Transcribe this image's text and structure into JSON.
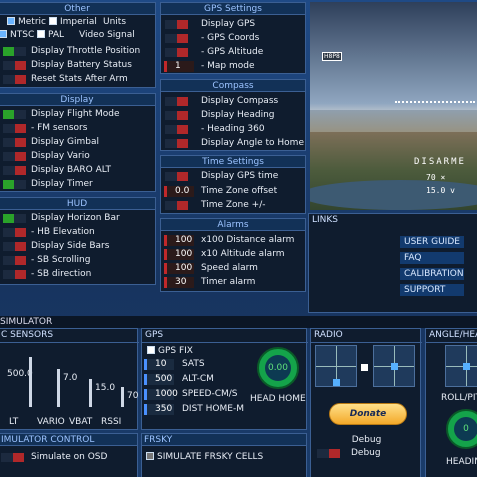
{
  "colors": {
    "on": "#2aa22a",
    "off": "#b0282a"
  },
  "other": {
    "title": "Other",
    "units": [
      "Metric",
      "Imperial",
      "Units"
    ],
    "video": [
      "NTSC",
      "PAL",
      "Video Signal"
    ],
    "items": [
      {
        "label": "Display Throttle Position",
        "state": "on"
      },
      {
        "label": "Display Battery Status",
        "state": "off"
      },
      {
        "label": "Reset Stats After Arm",
        "state": "off"
      }
    ]
  },
  "display": {
    "title": "Display",
    "items": [
      {
        "label": "Display Flight Mode",
        "state": "on"
      },
      {
        "label": "- FM sensors",
        "state": "off"
      },
      {
        "label": "Display Gimbal",
        "state": "off"
      },
      {
        "label": "Display Vario",
        "state": "off"
      },
      {
        "label": "Display BARO ALT",
        "state": "off"
      },
      {
        "label": "Display Timer",
        "state": "on"
      }
    ]
  },
  "hud": {
    "title": "HUD",
    "items": [
      {
        "label": "Display Horizon Bar",
        "state": "on"
      },
      {
        "label": "- HB Elevation",
        "state": "off"
      },
      {
        "label": "Display Side Bars",
        "state": "off"
      },
      {
        "label": "- SB Scrolling",
        "state": "off"
      },
      {
        "label": "- SB direction",
        "state": "off"
      }
    ]
  },
  "gps_settings": {
    "title": "GPS Settings",
    "items": [
      {
        "label": "Display GPS",
        "state": "off"
      },
      {
        "label": "- GPS Coords",
        "state": "off"
      },
      {
        "label": "- GPS Altitude",
        "state": "off"
      }
    ],
    "map_mode": {
      "value": "1",
      "label": "- Map mode"
    }
  },
  "compass": {
    "title": "Compass",
    "items": [
      {
        "label": "Display Compass",
        "state": "off"
      },
      {
        "label": "Display Heading",
        "state": "off"
      },
      {
        "label": "- Heading 360",
        "state": "off"
      },
      {
        "label": "Display Angle to Home",
        "state": "off"
      }
    ]
  },
  "time_settings": {
    "title": "Time Settings",
    "gps_time": {
      "label": "Display GPS time",
      "state": "off"
    },
    "offset": {
      "value": "0.0",
      "label": "Time Zone offset"
    },
    "plusminus": {
      "label": "Time Zone +/-",
      "state": "off"
    }
  },
  "alarms": {
    "title": "Alarms",
    "items": [
      {
        "value": "100",
        "label": "x100 Distance alarm"
      },
      {
        "value": "100",
        "label": "x10  Altitude alarm"
      },
      {
        "value": "100",
        "label": "Speed alarm"
      },
      {
        "value": "30",
        "label": "Timer alarm"
      }
    ]
  },
  "preview": {
    "top_badge": "H8P8",
    "speed": "70 ×",
    "alt": "15.0 v",
    "status": "DISARME"
  },
  "links": {
    "title": "LINKS",
    "items": [
      "USER GUIDE",
      "FAQ",
      "CALIBRATION",
      "SUPPORT"
    ]
  },
  "simulator": {
    "title": "SIMULATOR",
    "sensors_title": "C SENSORS",
    "sensors": [
      {
        "label": "LT",
        "value": ""
      },
      {
        "label": "VARIO",
        "value": "7.0"
      },
      {
        "label": "VBAT",
        "value": "15.0"
      },
      {
        "label": "RSSI",
        "value": "70"
      }
    ],
    "alt_value": "500.0",
    "control_title": "IMULATOR CONTROL",
    "simulate_osd": "Simulate on OSD"
  },
  "gps_sim": {
    "title": "GPS",
    "fix": "GPS FIX",
    "items": [
      {
        "value": "10",
        "label": "SATS"
      },
      {
        "value": "500",
        "label": "ALT-CM"
      },
      {
        "value": "1000",
        "label": "SPEED-CM/S"
      },
      {
        "value": "350",
        "label": "DIST HOME-M"
      }
    ],
    "head_value": "0.00",
    "head_label": "HEAD HOME"
  },
  "radio": {
    "title": "RADIO",
    "donate": "Donate",
    "debug_title": "Debug",
    "debug_label": "Debug"
  },
  "angle": {
    "title": "ANGLE/HEA",
    "roll": "ROLL/PIT",
    "heading": "HEADIN",
    "heading_value": "0"
  },
  "frsky": {
    "title": "FRSKY",
    "label": "SIMULATE FRSKY CELLS"
  }
}
